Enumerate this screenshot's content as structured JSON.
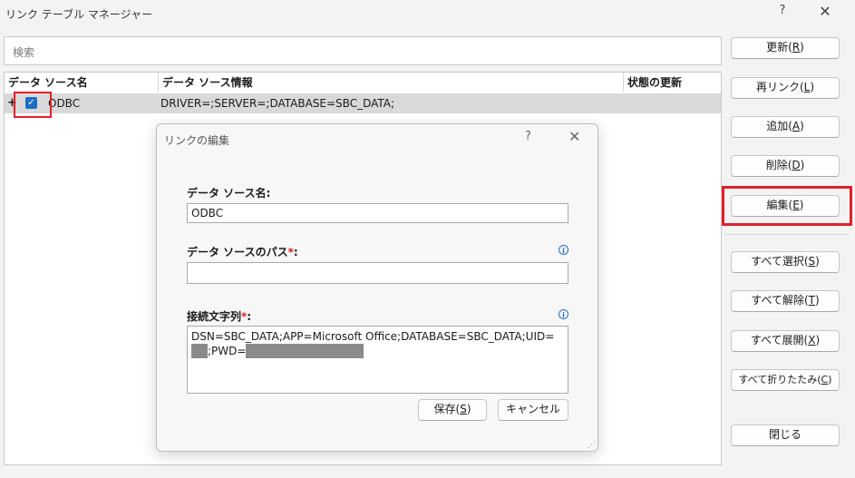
{
  "window": {
    "title": "リンク テーブル マネージャー",
    "help_glyph": "?",
    "close_glyph": "✕"
  },
  "search": {
    "placeholder": "検索"
  },
  "table": {
    "headers": [
      "データ ソース名",
      "データ ソース情報",
      "状態の更新"
    ],
    "rows": [
      {
        "expander": "+",
        "checked": true,
        "check_glyph": "✓",
        "name": "ODBC",
        "info": "DRIVER=;SERVER=;DATABASE=SBC_DATA;",
        "status": ""
      }
    ]
  },
  "buttons": {
    "refresh": {
      "text": "更新(",
      "key": "R",
      "end": ")"
    },
    "relink": {
      "text": "再リンク(",
      "key": "L",
      "end": ")"
    },
    "add": {
      "text": "追加(",
      "key": "A",
      "end": ")"
    },
    "delete": {
      "text": "削除(",
      "key": "D",
      "end": ")"
    },
    "edit": {
      "text": "編集(",
      "key": "E",
      "end": ")"
    },
    "select_all": {
      "text": "すべて選択(",
      "key": "S",
      "end": ")"
    },
    "deselect_all": {
      "text": "すべて解除(",
      "key": "T",
      "end": ")"
    },
    "expand_all": {
      "text": "すべて展開(",
      "key": "X",
      "end": ")"
    },
    "collapse_all": {
      "text": "すべて折りたたみ(",
      "key": "C",
      "end": ")"
    },
    "close": {
      "text": "閉じる"
    }
  },
  "dialog": {
    "title": "リンクの編集",
    "help_glyph": "?",
    "close_glyph": "✕",
    "name_label": "データ ソース名:",
    "name_value": "ODBC",
    "path_label": "データ ソースのパス",
    "path_value": "",
    "conn_label": "接続文字列",
    "required_mark": "*",
    "colon": ":",
    "info_glyph": "i",
    "conn_part1": "DSN=SBC_DATA;APP=Microsoft Office;DATABASE=SBC_DATA;UID=",
    "conn_part2": ";PWD=",
    "save": {
      "text": "保存(",
      "key": "S",
      "end": ")"
    },
    "cancel": {
      "text": "キャンセル"
    },
    "resize_grip": "⋰"
  },
  "colors": {
    "highlight_red": "#e0202a",
    "checkbox_blue": "#1f6fc5",
    "selected_row": "#d9d9d9"
  }
}
